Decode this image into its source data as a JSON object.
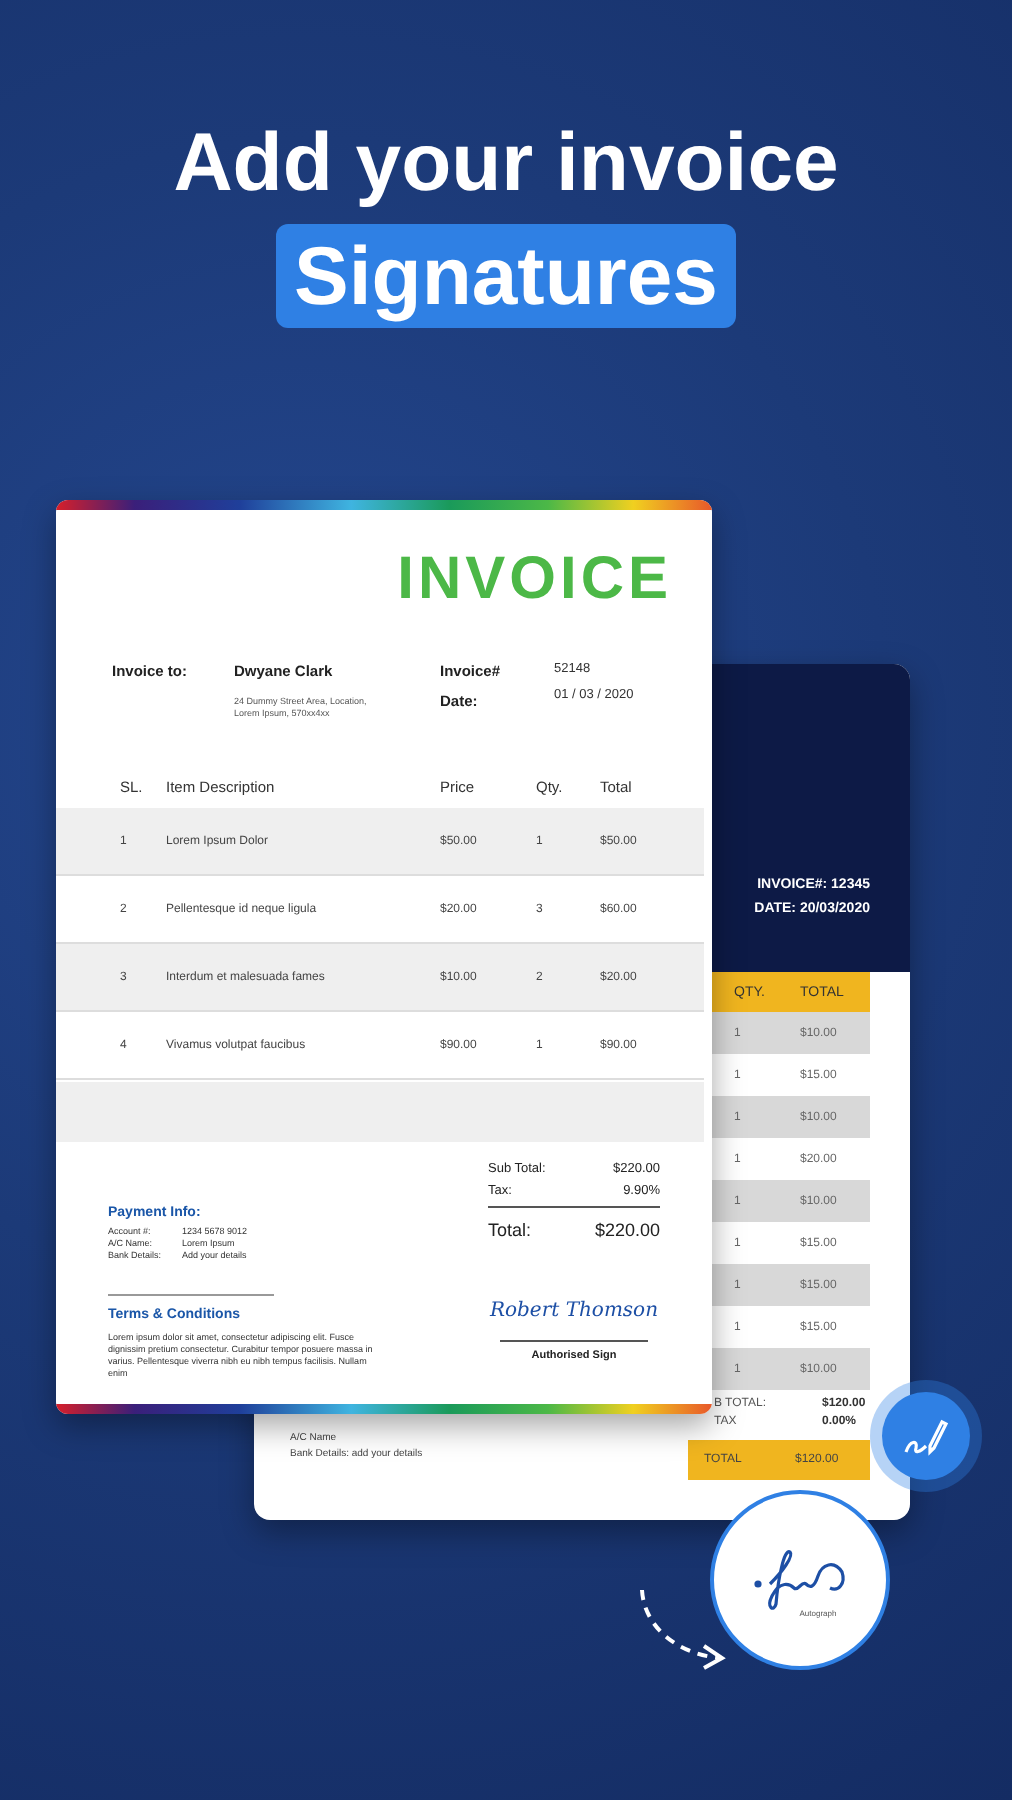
{
  "headline": {
    "line1": "Add your invoice",
    "highlight": "Signatures"
  },
  "front_invoice": {
    "title": "INVOICE",
    "bill_to_label": "Invoice to:",
    "client_name": "Dwyane Clark",
    "client_address": "24 Dummy Street Area, Location, Lorem Ipsum, 570xx4xx",
    "invoice_no_label": "Invoice#",
    "invoice_no": "52148",
    "date_label": "Date:",
    "date": "01 / 03 / 2020",
    "columns": [
      "SL.",
      "Item Description",
      "Price",
      "Qty.",
      "Total"
    ],
    "rows": [
      {
        "sl": "1",
        "description": "Lorem Ipsum Dolor",
        "price": "$50.00",
        "qty": "1",
        "total": "$50.00"
      },
      {
        "sl": "2",
        "description": "Pellentesque id neque ligula",
        "price": "$20.00",
        "qty": "3",
        "total": "$60.00"
      },
      {
        "sl": "3",
        "description": "Interdum et malesuada fames",
        "price": "$10.00",
        "qty": "2",
        "total": "$20.00"
      },
      {
        "sl": "4",
        "description": "Vivamus volutpat faucibus",
        "price": "$90.00",
        "qty": "1",
        "total": "$90.00"
      }
    ],
    "summary": [
      {
        "kind": "line",
        "label": "Sub Total:",
        "value": "$220.00"
      },
      {
        "kind": "line",
        "label": "Tax:",
        "value": "9.90%"
      },
      {
        "kind": "grand",
        "label": "Total:",
        "value": "$220.00"
      }
    ],
    "payment": {
      "title": "Payment Info:",
      "lines": [
        {
          "label": "Account #:",
          "value": "1234 5678 9012"
        },
        {
          "label": "A/C Name:",
          "value": "Lorem Ipsum"
        },
        {
          "label": "Bank Details:",
          "value": "Add your details"
        }
      ]
    },
    "terms": {
      "title": "Terms & Conditions",
      "text": "Lorem ipsum dolor sit amet, consectetur adipiscing elit. Fusce dignissim pretium consectetur. Curabitur tempor posuere massa in varius. Pellentesque viverra nibh eu nibh tempus facilisis. Nullam enim"
    },
    "signature_name": "Robert Thomson",
    "sign_label": "Authorised Sign"
  },
  "back_invoice": {
    "invoice_line": "INVOICE#: 12345",
    "date_line": "DATE: 20/03/2020",
    "columns": [
      "QTY.",
      "TOTAL"
    ],
    "rows": [
      {
        "qty": "1",
        "total": "$10.00"
      },
      {
        "qty": "1",
        "total": "$15.00"
      },
      {
        "qty": "1",
        "total": "$10.00"
      },
      {
        "qty": "1",
        "total": "$20.00"
      },
      {
        "qty": "1",
        "total": "$10.00"
      },
      {
        "qty": "1",
        "total": "$15.00"
      },
      {
        "qty": "1",
        "total": "$15.00"
      },
      {
        "qty": "1",
        "total": "$15.00"
      },
      {
        "qty": "1",
        "total": "$10.00"
      }
    ],
    "summary": [
      {
        "label": "B TOTAL:",
        "value": "$120.00"
      },
      {
        "label": "TAX",
        "value": "0.00%"
      }
    ],
    "total": {
      "label": "TOTAL",
      "value": "$120.00"
    },
    "bank_lines": [
      "A/C Name",
      "Bank Details: add your details"
    ]
  },
  "signature_stamp": {
    "caption": "Autograph"
  }
}
